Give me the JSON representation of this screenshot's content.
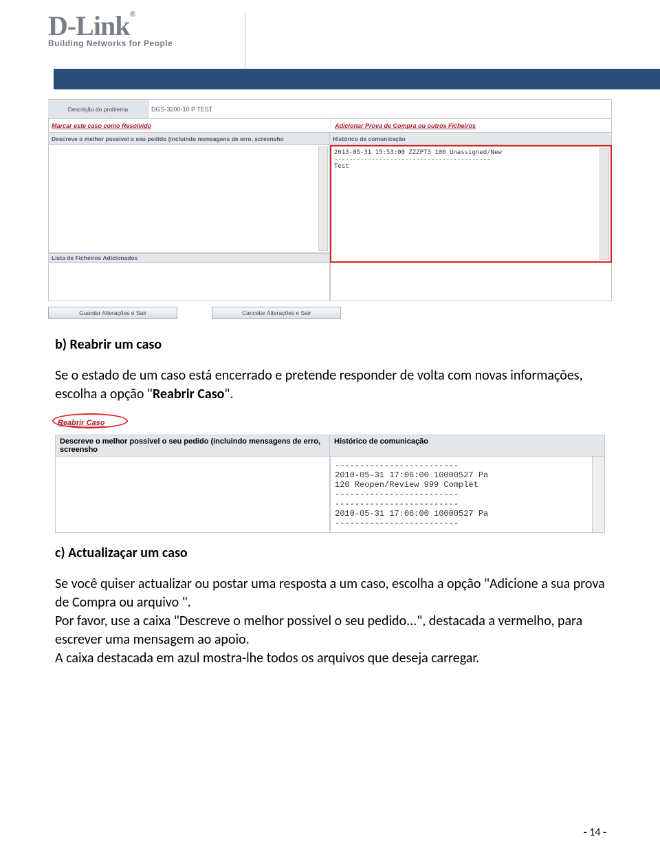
{
  "logo": {
    "brand": "D-Link",
    "reg": "®",
    "tagline": "Building Networks for People"
  },
  "ss1": {
    "desc_lbl": "Descrição do problema",
    "desc_val": "DGS-3200-10 P TEST",
    "link_resolve": "Marcar este caso como Resolvido",
    "link_addproof": "Adicionar Prova de Compra ou outros Ficheiros",
    "desc_hdr": "Descreve o melhor possivel o seu pedido (incluindo mensagens de erro, screensho",
    "hist_hdr": "Histórico de comunicação",
    "hist_line1": "2013-05-31  15:53:00  ZZZPT3  100  Unassigned/New",
    "hist_line2": "------------------------------------------",
    "hist_line3": "Test",
    "files_hdr": "Lista de Ficheiros Adicionados",
    "btn_save": "Guardar Alterações e Sair",
    "btn_cancel": "Cancelar Alterações e Sair"
  },
  "section_b": {
    "title": "b) Reabrir um caso",
    "p1a": "Se o estado de um caso está encerrado e pretende responder de volta com novas informações, escolha a opção \"",
    "p1b": "Reabrir Caso",
    "p1c": "\"."
  },
  "ss2": {
    "reabrir": "Reabrir Caso",
    "desc_hdr": "Descreve o melhor possivel o seu pedido (incluindo mensagens de erro, screensho",
    "hist_hdr": "Histórico de comunicação",
    "lines": [
      "-------------------------",
      "2010-05-31 17:06:00 10000527 Pa",
      "120 Reopen/Review   999 Complet",
      "-------------------------",
      "",
      "-------------------------",
      "2010-05-31 17:06:00 10000527 Pa",
      "-------------------------"
    ]
  },
  "section_c": {
    "title": "c) Actualizaçar um caso",
    "p1": "Se você quiser actualizar ou postar uma resposta a um caso, escolha a opção \"Adicione a sua prova de Compra ou arquivo \".",
    "p2a": "Por favor, use a caixa \"",
    "p2b": "Descreve o melhor possivel o seu pedido...",
    "p2c": "\", destacada a vermelho, para escrever uma mensagem ao apoio.",
    "p3": "A caixa destacada em azul mostra-lhe todos os arquivos que deseja carregar."
  },
  "footer": "- 14 -"
}
